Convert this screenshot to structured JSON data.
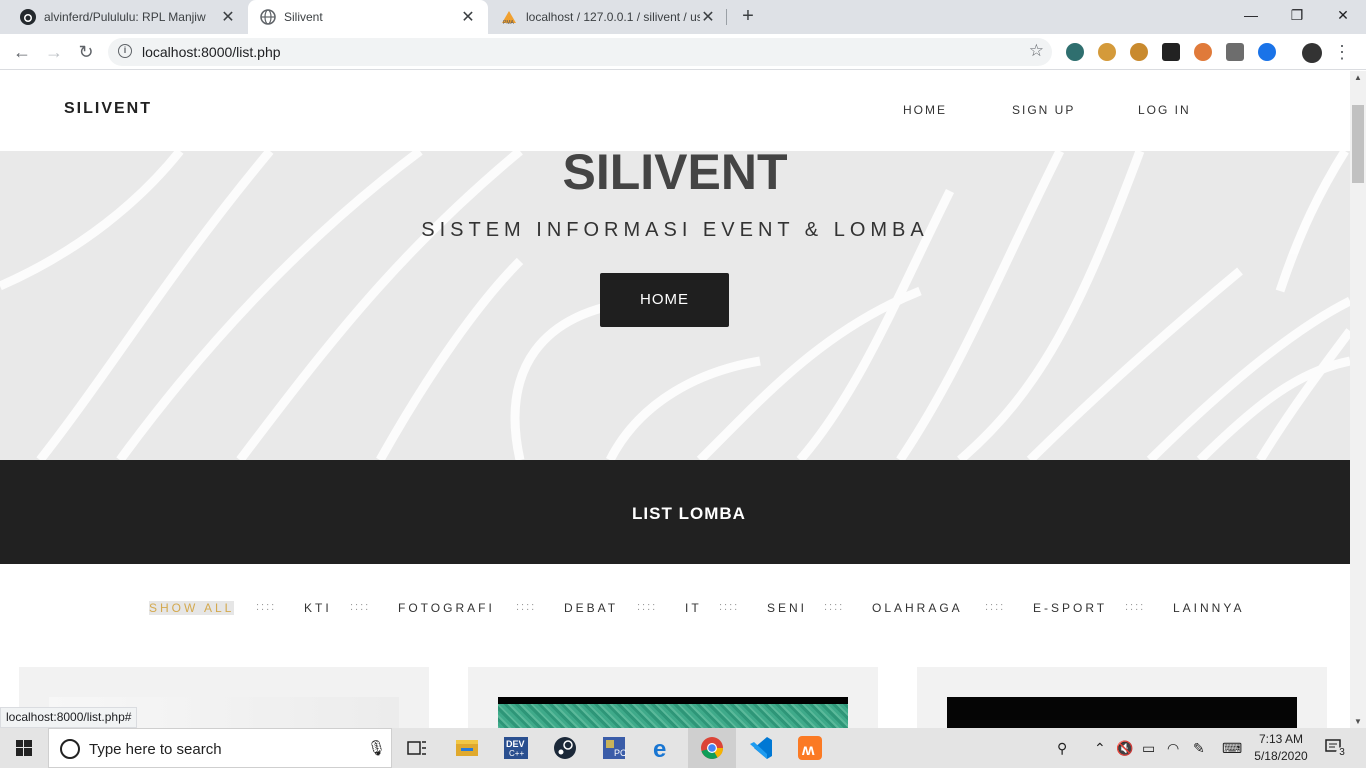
{
  "browser": {
    "tabs": [
      {
        "title": "alvinferd/Pulululu: RPL Manjiw",
        "icon": "github-icon",
        "close": "✕"
      },
      {
        "title": "Silivent",
        "icon": "globe-icon",
        "close": "✕"
      },
      {
        "title": "localhost / 127.0.0.1 / silivent / us",
        "icon": "phpmyadmin-icon",
        "close": "✕"
      }
    ],
    "new_tab": "+",
    "window_controls": {
      "minimize": "—",
      "maximize": "❐",
      "close": "✕"
    },
    "url": "localhost:8000/list.php",
    "status_url": "localhost:8000/list.php#"
  },
  "site": {
    "brand": "SILIVENT",
    "nav": [
      "HOME",
      "SIGN UP",
      "LOG IN"
    ],
    "hero_title": "SILIVENT",
    "hero_subtitle": "SISTEM INFORMASI EVENT & LOMBA",
    "hero_button": "HOME",
    "section_title": "LIST LOMBA",
    "filters": [
      "SHOW ALL",
      "KTI",
      "FOTOGRAFI",
      "DEBAT",
      "IT",
      "SENI",
      "OLAHRAGA",
      "E-SPORT",
      "LAINNYA"
    ],
    "filter_separator": "::::",
    "active_filter": "SHOW ALL"
  },
  "taskbar": {
    "search_placeholder": "Type here to search",
    "time": "7:13 AM",
    "date": "5/18/2020",
    "notification_count": "3",
    "pinned_apps": [
      "task-view-icon",
      "file-explorer-icon",
      "dev-cpp-icon",
      "steam-icon",
      "free-pascal-icon",
      "edge-icon",
      "chrome-icon",
      "vscode-icon",
      "xampp-icon"
    ]
  }
}
